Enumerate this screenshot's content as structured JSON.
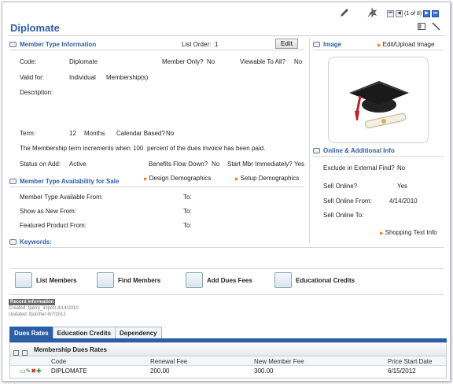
{
  "header": {
    "title": "Diplomate",
    "record_nav": "(1 of 8)",
    "nav_first": "⏮",
    "nav_prev": "◀",
    "nav_next": "▶",
    "nav_last": "⏭"
  },
  "member_type_info": {
    "section_title": "Member Type Information",
    "list_order_label": "List Order:",
    "list_order_value": "1",
    "edit_label": "Edit",
    "code_label": "Code:",
    "code_value": "Diplomate",
    "member_only_label": "Member Only?",
    "member_only_value": "No",
    "viewable_label": "Viewable To All?",
    "viewable_value": "No",
    "valid_for_label": "Valid for:",
    "valid_for_value": "Individual",
    "valid_for_suffix": "Membership(s)",
    "description_label": "Description:",
    "term_label": "Term:",
    "term_value": "12",
    "term_unit": "Months",
    "calendar_label": "Calendar Based?",
    "calendar_value": "No",
    "increments_text_1": "The Membership term increments when",
    "increments_value": "100",
    "increments_text_2": "percent of the dues invoice has been paid.",
    "status_label": "Status on Add:",
    "status_value": "Active",
    "benefits_label": "Benefits Flow Down?",
    "benefits_value": "No",
    "start_mbr_label": "Start Mbr Immediately?",
    "start_mbr_value": "Yes"
  },
  "availability": {
    "section_title": "Member Type Availability for Sale",
    "design_demo": "Design Demographics",
    "setup_demo": "Setup Demographics",
    "available_from": "Member Type Available From:",
    "show_new_from": "Show as New From:",
    "featured_from": "Featured Product From:",
    "to_label": "To:"
  },
  "keywords": {
    "section_title": "Keywords:"
  },
  "image": {
    "section_title": "Image",
    "edit_upload": "Edit/Upload Image",
    "picture_name": "graduation-cap-diploma"
  },
  "online": {
    "section_title": "Online & Additional Info",
    "exclude_label": "Exclude in External Find?",
    "exclude_value": "No",
    "sell_online_label": "Sell Online?",
    "sell_online_value": "Yes",
    "sell_from_label": "Sell Online From:",
    "sell_from_value": "4/14/2010",
    "sell_to_label": "Sell Online To:",
    "shopping_text": "Shopping Text Info"
  },
  "actions": {
    "list_members": "List Members",
    "find_members": "Find Members",
    "add_dues_fees": "Add Dues Fees",
    "educational_credits": "Educational Credits"
  },
  "record_info": {
    "heading": "Record Information",
    "created": "Created: tperry_import-4/14/2010",
    "updated": "Updated: lbutcher-8/7/2012"
  },
  "tabs": [
    "Dues Rates",
    "Education Credits",
    "Dependency"
  ],
  "dues_grid": {
    "title": "Membership Dues Rates",
    "columns": [
      "Code",
      "Renewal Fee",
      "New Member Fee",
      "Price Start Date"
    ],
    "rows": [
      {
        "code": "DIPLOMATE",
        "renewal_fee": "200.00",
        "new_member_fee": "300.00",
        "price_start_date": "6/15/2012"
      }
    ]
  },
  "colors": {
    "accent": "#2b5ea7",
    "link_arrow": "#f08010"
  }
}
